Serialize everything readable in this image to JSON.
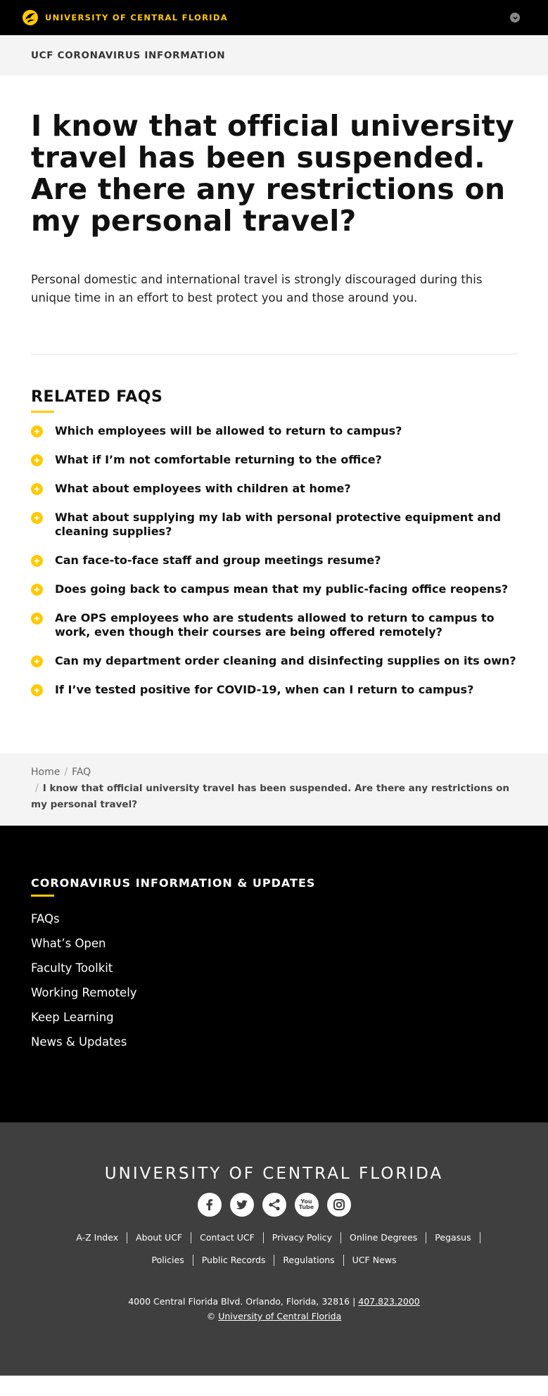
{
  "header": {
    "brand_name": "UNIVERSITY OF CENTRAL FLORIDA",
    "sub_title": "UCF CORONAVIRUS INFORMATION"
  },
  "main": {
    "title": "I know that official university travel has been suspended. Are there any restrictions on my personal travel?",
    "body": "Personal domestic and international travel is strongly discouraged during this unique time in an effort to best protect you and those around you."
  },
  "related": {
    "title": "RELATED FAQS",
    "items": [
      "Which employees will be allowed to return to campus?",
      "What if I’m not comfortable returning to the office?",
      "What about employees with children at home?",
      "What about supplying my lab with personal protective equipment and cleaning supplies?",
      "Can face-to-face staff and group meetings resume?",
      "Does going back to campus mean that my public-facing office reopens?",
      "Are OPS employees who are students allowed to return to campus to work, even though their courses are being offered remotely?",
      "Can my department order cleaning and disinfecting supplies on its own?",
      "If I’ve tested positive for COVID-19, when can I return to campus?"
    ]
  },
  "breadcrumb": {
    "home": "Home",
    "faq": "FAQ",
    "current": "I know that official university travel has been suspended. Are there any restrictions on my personal travel?"
  },
  "footer": {
    "section_title": "CORONAVIRUS INFORMATION & UPDATES",
    "links": [
      "FAQs",
      "What’s Open",
      "Faculty Toolkit",
      "Working Remotely",
      "Keep Learning",
      "News & Updates"
    ],
    "university": "UNIVERSITY OF CENTRAL FLORIDA",
    "nav_row1": [
      "A-Z Index",
      "About UCF",
      "Contact UCF",
      "Privacy Policy",
      "Online Degrees",
      "Pegasus"
    ],
    "nav_row2": [
      "Policies",
      "Public Records",
      "Regulations",
      "UCF News"
    ],
    "address": "4000 Central Florida Blvd. Orlando, Florida, 32816 |",
    "phone": "407.823.2000",
    "copyright_symbol": "©",
    "copyright_link": "University of Central Florida",
    "youtube_label_1": "You",
    "youtube_label_2": "Tube"
  },
  "colors": {
    "accent": "#ffc904",
    "black": "#000000",
    "footer_grey": "#3f3f3f"
  }
}
